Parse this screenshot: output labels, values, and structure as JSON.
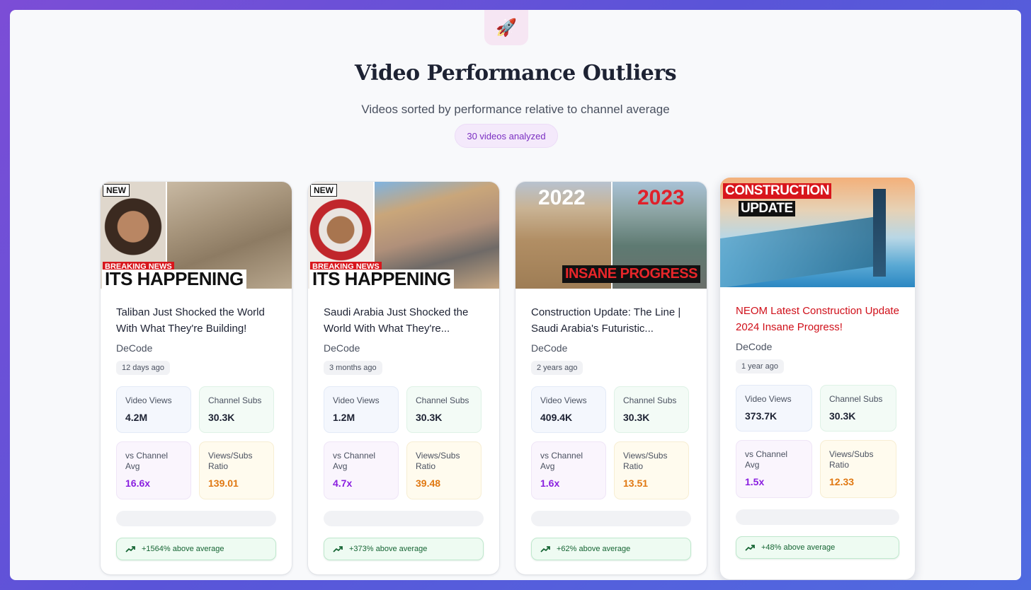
{
  "header": {
    "icon": "rocket-icon",
    "icon_glyph": "🚀",
    "title": "Video Performance Outliers",
    "subtitle": "Videos sorted by performance relative to channel average",
    "count_label": "30 videos analyzed"
  },
  "labels": {
    "video_views": "Video Views",
    "channel_subs": "Channel Subs",
    "vs_channel_avg": "vs Channel Avg",
    "views_subs_ratio": "Views/Subs Ratio"
  },
  "colors": {
    "multiplier": "#8a1fe0",
    "ratio": "#e07812",
    "highlight_title": "#d0101a",
    "positive": "#166534"
  },
  "videos": [
    {
      "title": "Taliban Just Shocked the World With What They're Building!",
      "channel": "DeCode",
      "age": "12 days ago",
      "views": "4.2M",
      "subs": "30.3K",
      "vs_avg": "16.6x",
      "ratio": "139.01",
      "performance": "+1564% above average",
      "thumb_text": {
        "badge": "NEW",
        "strap": "BREAKING NEWS",
        "headline": "ITS HAPPENING"
      }
    },
    {
      "title": "Saudi Arabia Just Shocked the World With What They're...",
      "channel": "DeCode",
      "age": "3 months ago",
      "views": "1.2M",
      "subs": "30.3K",
      "vs_avg": "4.7x",
      "ratio": "39.48",
      "performance": "+373% above average",
      "thumb_text": {
        "badge": "NEW",
        "strap": "BREAKING NEWS",
        "headline": "ITS HAPPENING"
      }
    },
    {
      "title": "Construction Update: The Line | Saudi Arabia's Futuristic...",
      "channel": "DeCode",
      "age": "2 years ago",
      "views": "409.4K",
      "subs": "30.3K",
      "vs_avg": "1.6x",
      "ratio": "13.51",
      "performance": "+62% above average",
      "thumb_text": {
        "year_left": "2022",
        "year_right": "2023",
        "headline": "INSANE PROGRESS"
      }
    },
    {
      "title": "NEOM Latest Construction Update 2024 Insane Progress!",
      "channel": "DeCode",
      "age": "1 year ago",
      "views": "373.7K",
      "subs": "30.3K",
      "vs_avg": "1.5x",
      "ratio": "12.33",
      "performance": "+48% above average",
      "thumb_text": {
        "line1": "CONSTRUCTION",
        "line2": "UPDATE"
      }
    }
  ]
}
